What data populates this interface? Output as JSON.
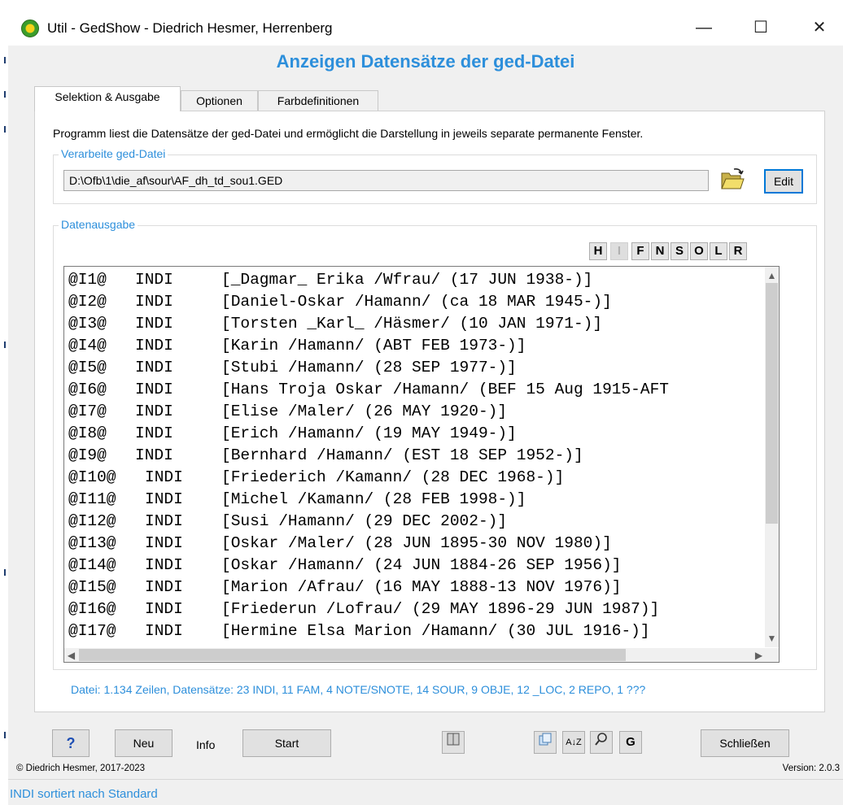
{
  "window": {
    "title": "Util - GedShow  -  Diedrich Hesmer, Herrenberg",
    "minimize_glyph": "—",
    "maximize_glyph": "☐",
    "close_glyph": "✕"
  },
  "heading": "Anzeigen Datensätze der ged-Datei",
  "tabs": [
    {
      "label": "Selektion & Ausgabe",
      "active": true
    },
    {
      "label": "Optionen",
      "active": false
    },
    {
      "label": "Farbdefinitionen",
      "active": false
    }
  ],
  "description": "Programm liest die Datensätze der ged-Datei und ermöglicht die Darstellung in jeweils separate permanente Fenster.",
  "input_group": {
    "legend": "Verarbeite ged-Datei",
    "path": "D:\\Ofb\\1\\die_af\\sour\\AF_dh_td_sou1.GED",
    "edit_label": "Edit"
  },
  "output_group": {
    "legend": "Datenausgabe",
    "selectors": [
      {
        "label": "H",
        "enabled": true
      },
      {
        "label": "I",
        "enabled": false
      },
      {
        "label": "F",
        "enabled": true
      },
      {
        "label": "N",
        "enabled": true
      },
      {
        "label": "S",
        "enabled": true
      },
      {
        "label": "O",
        "enabled": true
      },
      {
        "label": "L",
        "enabled": true
      },
      {
        "label": "R",
        "enabled": true
      }
    ],
    "records": [
      {
        "id": "@I1@",
        "type": "INDI",
        "text": "[_Dagmar_ Erika /Wfrau/ (17 JUN 1938-)]"
      },
      {
        "id": "@I2@",
        "type": "INDI",
        "text": "[Daniel-Oskar /Hamann/ (ca 18 MAR 1945-)]"
      },
      {
        "id": "@I3@",
        "type": "INDI",
        "text": "[Torsten _Karl_ /Häsmer/ (10 JAN 1971-)]"
      },
      {
        "id": "@I4@",
        "type": "INDI",
        "text": "[Karin /Hamann/ (ABT FEB 1973-)]"
      },
      {
        "id": "@I5@",
        "type": "INDI",
        "text": "[Stubi /Hamann/ (28 SEP 1977-)]"
      },
      {
        "id": "@I6@",
        "type": "INDI",
        "text": "[Hans Troja Oskar /Hamann/ (BEF 15 Aug 1915-AFT"
      },
      {
        "id": "@I7@",
        "type": "INDI",
        "text": "[Elise /Maler/ (26 MAY 1920-)]"
      },
      {
        "id": "@I8@",
        "type": "INDI",
        "text": "[Erich /Hamann/ (19 MAY 1949-)]"
      },
      {
        "id": "@I9@",
        "type": "INDI",
        "text": "[Bernhard /Hamann/ (EST 18 SEP 1952-)]"
      },
      {
        "id": "@I10@",
        "type": "INDI",
        "text": "[Friederich /Kamann/ (28 DEC 1968-)]"
      },
      {
        "id": "@I11@",
        "type": "INDI",
        "text": "[Michel /Kamann/ (28 FEB 1998-)]"
      },
      {
        "id": "@I12@",
        "type": "INDI",
        "text": "[Susi /Hamann/ (29 DEC 2002-)]"
      },
      {
        "id": "@I13@",
        "type": "INDI",
        "text": "[Oskar /Maler/ (28 JUN 1895-30 NOV 1980)]"
      },
      {
        "id": "@I14@",
        "type": "INDI",
        "text": "[Oskar /Hamann/ (24 JUN 1884-26 SEP 1956)]"
      },
      {
        "id": "@I15@",
        "type": "INDI",
        "text": "[Marion /Afrau/ (16 MAY 1888-13 NOV 1976)]"
      },
      {
        "id": "@I16@",
        "type": "INDI",
        "text": "[Friederun /Lofrau/ (29 MAY 1896-29 JUN 1987)]"
      },
      {
        "id": "@I17@",
        "type": "INDI",
        "text": "[Hermine Elsa Marion /Hamann/ (30 JUL 1916-)]"
      }
    ],
    "stats": "Datei: 1.134 Zeilen, Datensätze: 23 INDI, 11 FAM, 4 NOTE/SNOTE, 14 SOUR, 9 OBJE, 12 _LOC, 2 REPO, 1 ???"
  },
  "bottom": {
    "help_label": "?",
    "new_label": "Neu",
    "info_label": "Info",
    "start_label": "Start",
    "close_label": "Schließen",
    "icons": [
      "book-icon",
      "copy-icon",
      "sort-az-icon",
      "search-icon",
      "ged-icon"
    ],
    "sort_glyph": "A↓Z",
    "ged_glyph": "G",
    "copyright": "© Diedrich Hesmer, 2017-2023",
    "version": "Version: 2.0.3"
  },
  "status": "INDI sortiert nach Standard",
  "colors": {
    "accent": "#2d8fdb",
    "help_blue": "#1e4fb4"
  }
}
